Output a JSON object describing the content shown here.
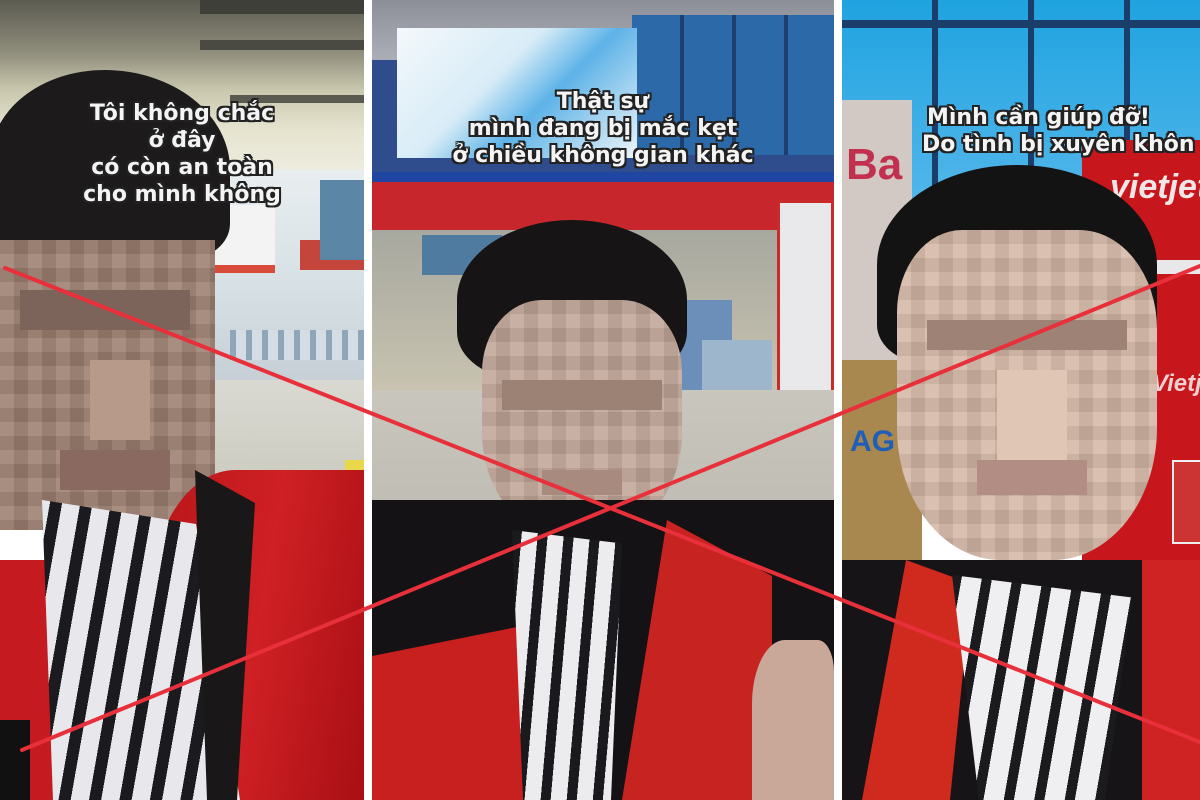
{
  "image": {
    "description": "Three-panel collage of video frames with captions, crossed out with a red X",
    "overlay_color": "#e8303a",
    "panels": [
      {
        "caption": [
          "Tôi không chắc",
          "ở đây",
          "có còn an toàn",
          "cho mình không"
        ],
        "scene": "airport terminal hall with blurred face of person in red jacket and striped shirt"
      },
      {
        "caption": [
          "Thật sự",
          "mình đang bị mắc kẹt",
          "ở chiều không gian khác"
        ],
        "scene": "airport check-in area with screen and blue-red signage"
      },
      {
        "caption": [
          "Mình cần giúp đỡ!",
          "Do tình bị xuyên khôn"
        ],
        "scene": "airport counter with Vietjet red signage",
        "signage": [
          "vietjet",
          "Vietjet",
          "AG",
          "Ba"
        ]
      }
    ]
  }
}
